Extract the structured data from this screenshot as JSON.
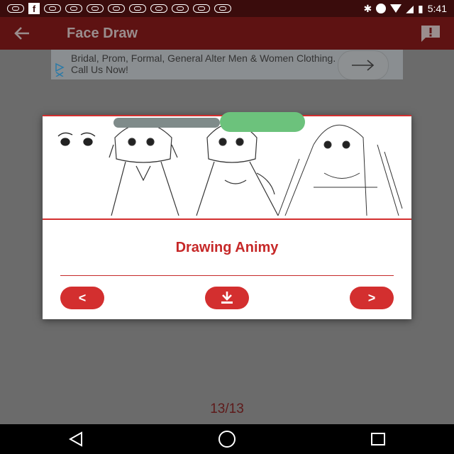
{
  "status_bar": {
    "time": "5:41",
    "facebook_glyph": "f"
  },
  "app_bar": {
    "title": "Face Draw"
  },
  "ad": {
    "text": "Bridal, Prom, Formal, General Alter Men & Women Clothing. Call Us Now!"
  },
  "dialog": {
    "title": "Drawing Animy",
    "prev_label": "<",
    "next_label": ">"
  },
  "pager": {
    "counter": "13/13"
  },
  "colors": {
    "accent": "#d32f2f",
    "appbar": "#5e1212",
    "title_red": "#c62828"
  }
}
